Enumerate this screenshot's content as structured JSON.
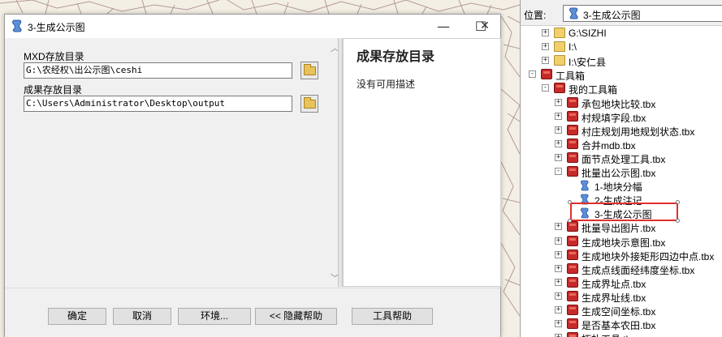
{
  "dialog": {
    "title": "3-生成公示图",
    "minimize_glyph": "—",
    "maximize_glyph": "☐",
    "close_glyph": "✕",
    "params": [
      {
        "label": "MXD存放目录",
        "value": "G:\\农经权\\出公示图\\ceshi"
      },
      {
        "label": "成果存放目录",
        "value": "C:\\Users\\Administrator\\Desktop\\output"
      }
    ],
    "scroll_up": "︿",
    "scroll_down": "﹀",
    "help": {
      "title": "成果存放目录",
      "description": "没有可用描述"
    },
    "buttons": {
      "ok": "确定",
      "cancel": "取消",
      "env": "环境...",
      "hide_help": "<< 隐藏帮助",
      "tool_help": "工具帮助"
    }
  },
  "catalog": {
    "location_label": "位置:",
    "location_value": "3-生成公示图",
    "tree": [
      {
        "label": "G:\\SIZHI",
        "icon": "folder-icon",
        "expander": "+"
      },
      {
        "label": "I:\\",
        "icon": "folder-icon",
        "expander": "+"
      },
      {
        "label": "I:\\安仁县",
        "icon": "folder-icon",
        "expander": "+"
      },
      {
        "label": "工具箱",
        "icon": "toolbox-icon",
        "expander": "-"
      },
      {
        "label": "我的工具箱",
        "icon": "toolbox-icon",
        "expander": "-"
      },
      {
        "label": "承包地块比较.tbx",
        "icon": "toolbox-icon",
        "expander": "+"
      },
      {
        "label": "村规填字段.tbx",
        "icon": "toolbox-icon",
        "expander": "+"
      },
      {
        "label": "村庄规划用地规划状态.tbx",
        "icon": "toolbox-icon",
        "expander": "+"
      },
      {
        "label": "合并mdb.tbx",
        "icon": "toolbox-icon",
        "expander": "+"
      },
      {
        "label": "面节点处理工具.tbx",
        "icon": "toolbox-icon",
        "expander": "+"
      },
      {
        "label": "批量出公示图.tbx",
        "icon": "toolbox-icon",
        "expander": "-"
      },
      {
        "label": "1-地块分幅",
        "icon": "script-icon",
        "expander": ""
      },
      {
        "label": "2-生成注记",
        "icon": "script-icon",
        "expander": ""
      },
      {
        "label": "3-生成公示图",
        "icon": "script-icon",
        "expander": ""
      },
      {
        "label": "批量导出图片.tbx",
        "icon": "toolbox-icon",
        "expander": "+"
      },
      {
        "label": "生成地块示意图.tbx",
        "icon": "toolbox-icon",
        "expander": "+"
      },
      {
        "label": "生成地块外接矩形四边中点.tbx",
        "icon": "toolbox-icon",
        "expander": "+"
      },
      {
        "label": "生成点线面经纬度坐标.tbx",
        "icon": "toolbox-icon",
        "expander": "+"
      },
      {
        "label": "生成界址点.tbx",
        "icon": "toolbox-icon",
        "expander": "+"
      },
      {
        "label": "生成界址线.tbx",
        "icon": "toolbox-icon",
        "expander": "+"
      },
      {
        "label": "生成空间坐标.tbx",
        "icon": "toolbox-icon",
        "expander": "+"
      },
      {
        "label": "是否基本农田.tbx",
        "icon": "toolbox-icon",
        "expander": "+"
      },
      {
        "label": "拓扑工具.tbx",
        "icon": "toolbox-icon",
        "expander": "+"
      }
    ]
  },
  "colors": {
    "highlight": "#e0302d",
    "map_line": "#b49a9a",
    "toolbox_red": "#c62a2a"
  }
}
